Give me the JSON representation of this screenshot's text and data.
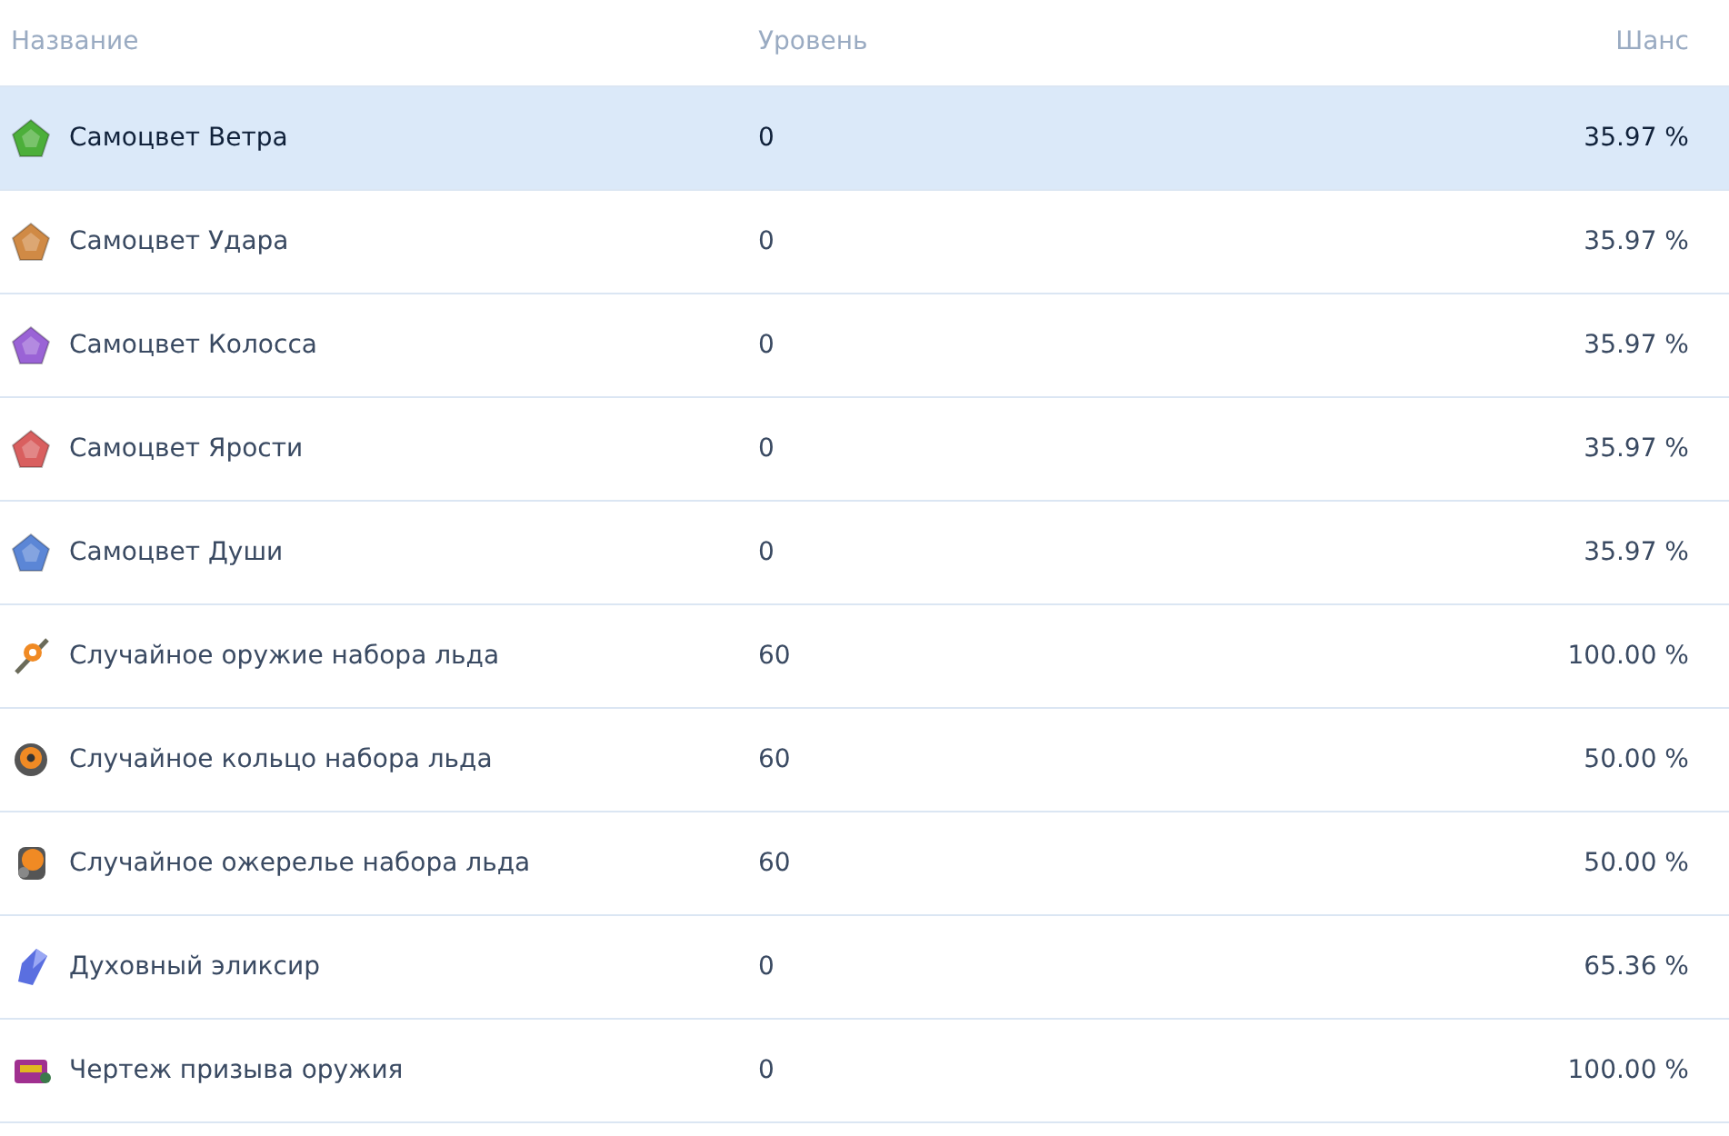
{
  "table": {
    "columns": [
      "Название",
      "Уровень",
      "Шанс"
    ],
    "rows": [
      {
        "kind": "gem",
        "color": "#4caf3a",
        "name": "Самоцвет Ветра",
        "level": "0",
        "chance": "35.97 %",
        "selected": true
      },
      {
        "kind": "gem",
        "color": "#d08a45",
        "name": "Самоцвет Удара",
        "level": "0",
        "chance": "35.97 %",
        "selected": false
      },
      {
        "kind": "gem",
        "color": "#9a63d6",
        "name": "Самоцвет Колосса",
        "level": "0",
        "chance": "35.97 %",
        "selected": false
      },
      {
        "kind": "gem",
        "color": "#d95f5f",
        "name": "Самоцвет Ярости",
        "level": "0",
        "chance": "35.97 %",
        "selected": false
      },
      {
        "kind": "gem",
        "color": "#5b86d6",
        "name": "Самоцвет Души",
        "level": "0",
        "chance": "35.97 %",
        "selected": false
      },
      {
        "kind": "weapon",
        "name": "Случайное оружие набора льда",
        "level": "60",
        "chance": "100.00 %",
        "selected": false
      },
      {
        "kind": "ring",
        "name": "Случайное кольцо набора льда",
        "level": "60",
        "chance": "50.00 %",
        "selected": false
      },
      {
        "kind": "necklace",
        "name": "Случайное ожерелье набора льда",
        "level": "60",
        "chance": "50.00 %",
        "selected": false
      },
      {
        "kind": "elixir",
        "name": "Духовный эликсир",
        "level": "0",
        "chance": "65.36 %",
        "selected": false
      },
      {
        "kind": "blueprint",
        "name": "Чертеж призыва оружия",
        "level": "0",
        "chance": "100.00 %",
        "selected": false
      }
    ]
  }
}
